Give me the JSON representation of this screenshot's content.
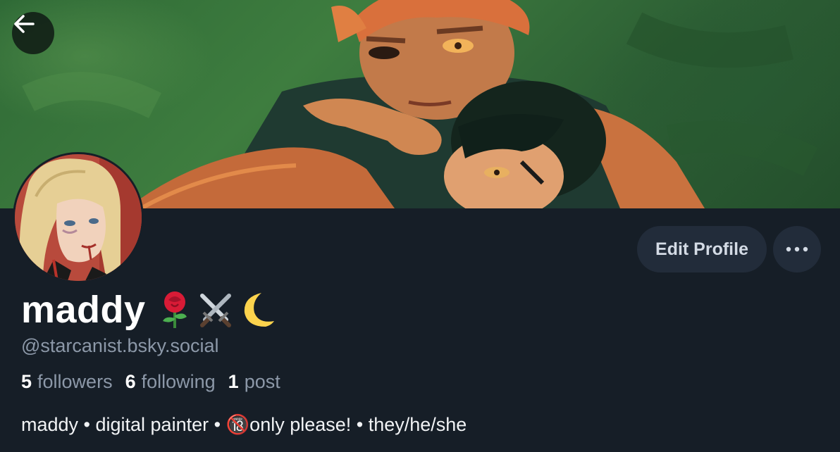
{
  "profile": {
    "display_name": "maddy",
    "name_emoji": [
      "rose-emoji",
      "crossed-swords-emoji",
      "crescent-moon-emoji"
    ],
    "handle": "@starcanist.bsky.social",
    "bio": "maddy • digital painter • 🔞only please! • they/he/she"
  },
  "stats": {
    "followers_count": "5",
    "followers_label": "followers",
    "following_count": "6",
    "following_label": "following",
    "posts_count": "1",
    "posts_label": "post"
  },
  "actions": {
    "edit_label": "Edit Profile",
    "more_icon": "ellipsis-icon",
    "back_icon": "arrow-left-icon"
  },
  "colors": {
    "background": "#161e27",
    "button_bg": "#222c3a",
    "muted_text": "#8c98a8",
    "banner_green": "#3e7d3f"
  }
}
